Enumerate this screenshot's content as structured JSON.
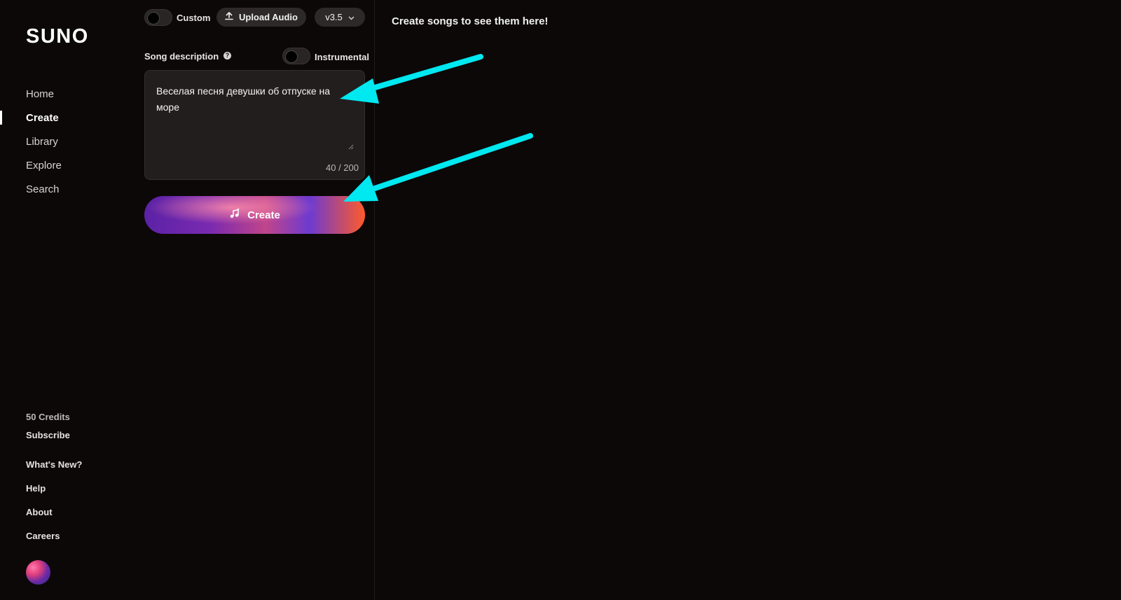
{
  "app": {
    "logo": "SUNO"
  },
  "sidebar": {
    "nav": [
      {
        "label": "Home"
      },
      {
        "label": "Create"
      },
      {
        "label": "Library"
      },
      {
        "label": "Explore"
      },
      {
        "label": "Search"
      }
    ],
    "credits": "50 Credits",
    "footer": [
      {
        "label": "Subscribe"
      },
      {
        "label": "What's New?"
      },
      {
        "label": "Help"
      },
      {
        "label": "About"
      },
      {
        "label": "Careers"
      }
    ]
  },
  "create_panel": {
    "custom_label": "Custom",
    "upload_label": "Upload Audio",
    "version": "v3.5",
    "description_label": "Song description",
    "instrumental_label": "Instrumental",
    "description_value": "Веселая песня девушки об отпуске на море",
    "char_counter": "40 / 200",
    "create_label": "Create"
  },
  "right_panel": {
    "empty_message": "Create songs to see them here!"
  },
  "colors": {
    "background": "#0c0808",
    "annotation_arrow": "#00e8f0"
  }
}
